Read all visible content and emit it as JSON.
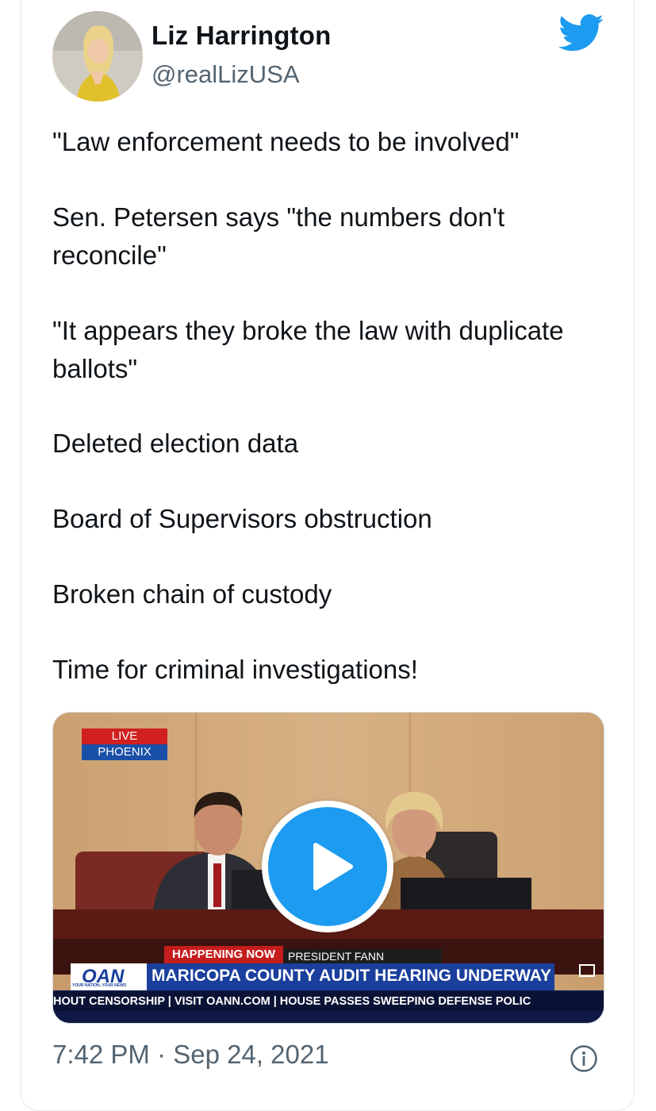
{
  "tweet": {
    "author_name": "Liz Harrington",
    "author_handle": "@realLizUSA",
    "paragraphs": [
      "\"Law enforcement needs to be involved\"",
      "Sen. Petersen says \"the numbers don't reconcile\"",
      "\"It appears they broke the law with duplicate ballots\"",
      "Deleted election data",
      "Board of Supervisors obstruction",
      "Broken chain of custody",
      "Time for criminal investigations!"
    ],
    "timestamp": "7:42 PM · Sep 24, 2021"
  },
  "video": {
    "live_label": "LIVE",
    "location_label": "PHOENIX",
    "happening_now": "HAPPENING NOW",
    "speaker_label": "PRESIDENT FANN",
    "network_logo": "OAN",
    "network_tagline": "YOUR NATION, YOUR NEWS",
    "headline": "MARICOPA COUNTY AUDIT HEARING UNDERWAY",
    "ticker": "HOUT CENSORSHIP  |  VISIT OANN.COM  |  HOUSE PASSES SWEEPING DEFENSE POLIC"
  },
  "icons": {
    "brand": "twitter-bird-icon",
    "play": "play-icon",
    "info": "info-icon"
  },
  "colors": {
    "brand_blue": "#1d9bf0",
    "secondary_text": "#536471",
    "text": "#0f1419"
  }
}
